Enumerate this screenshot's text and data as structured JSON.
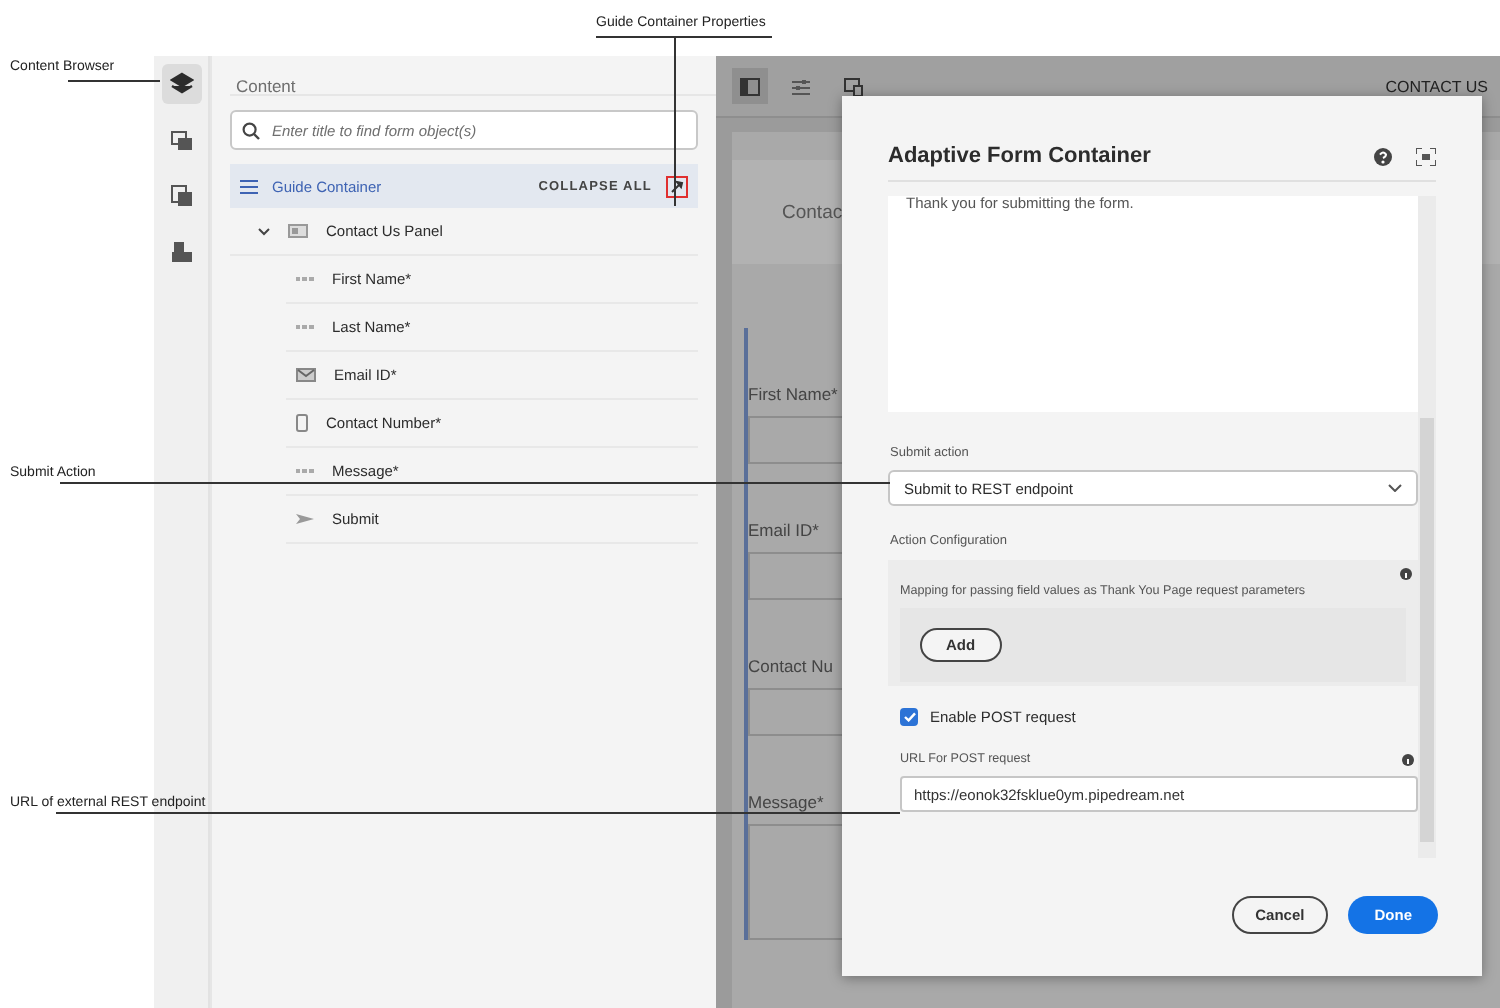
{
  "callouts": [
    {
      "text": "Content Browser"
    },
    {
      "text": "Guide Container Properties"
    },
    {
      "text": "Submit Action"
    },
    {
      "text": "URL of external REST endpoint"
    }
  ],
  "rail": {
    "items": [
      {
        "kind": "layers",
        "selected": true
      },
      {
        "kind": "assets",
        "selected": false
      },
      {
        "kind": "components",
        "selected": false
      },
      {
        "kind": "data",
        "selected": false
      }
    ]
  },
  "content_panel": {
    "title": "Content",
    "search": {
      "placeholder": "Enter title to find form object(s)"
    },
    "tree": {
      "label": "Guide Container",
      "selected": true,
      "action": "COLLAPSE ALL",
      "children": [
        {
          "label": "Contact Us Panel",
          "kind": "panel",
          "expanded": true,
          "children": [
            {
              "label": "First Name*",
              "kind": "text"
            },
            {
              "label": "Last Name*",
              "kind": "text"
            },
            {
              "label": "Email ID*",
              "kind": "email"
            },
            {
              "label": "Contact Number*",
              "kind": "phone"
            },
            {
              "label": "Message*",
              "kind": "text"
            },
            {
              "label": "Submit",
              "kind": "submit"
            }
          ]
        }
      ]
    }
  },
  "canvas": {
    "title": "CONTACT US",
    "heading": "Contac",
    "fields": [
      "First Name*",
      "Email ID*",
      "Contact Nu",
      "Message*"
    ]
  },
  "dialog": {
    "title": "Adaptive Form Container",
    "message": "Thank you for submitting the form.",
    "submit_action": {
      "label": "Submit action",
      "value": "Submit to REST endpoint"
    },
    "action_configuration": {
      "label": "Action Configuration",
      "mapping": "Mapping for passing field values as Thank You Page request parameters",
      "add_button": "Add"
    },
    "post": {
      "label": "Enable POST request",
      "checked": true
    },
    "url": {
      "label": "URL For POST request",
      "value": "https://eonok32fsklue0ym.pipedream.net"
    },
    "buttons": {
      "cancel": "Cancel",
      "done": "Done"
    }
  }
}
